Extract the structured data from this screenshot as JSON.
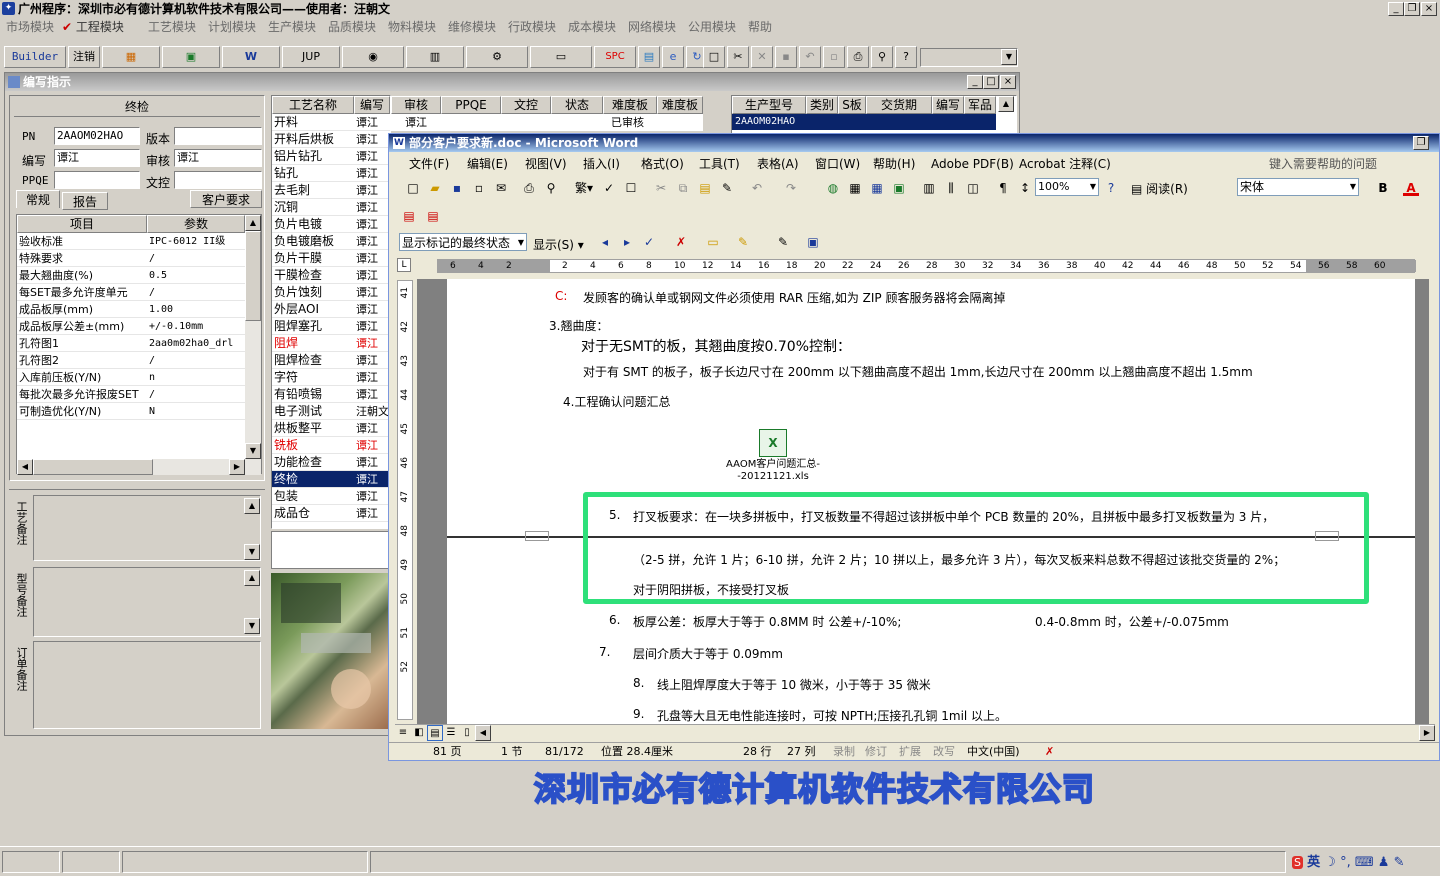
{
  "main_window": {
    "title": "广州程序：深圳市必有德计算机软件技术有限公司——使用者：汪朝文",
    "controls": [
      "_",
      "□",
      "×"
    ]
  },
  "menubar": [
    "市场模块",
    "✔ 工程模块",
    "工艺模块",
    "计划模块",
    "生产模块",
    "品质模块",
    "物料模块",
    "维修模块",
    "行政模块",
    "成本模块",
    "网络模块",
    "公用模块",
    "帮助"
  ],
  "toolbar": {
    "builder": "Builder",
    "logout": "注销",
    "jup": "JUP",
    "spc": "SPC"
  },
  "child_window": {
    "title": "编写指示",
    "panel_title": "终检",
    "fields": {
      "pn_label": "PN",
      "pn_value": "2AAOM02HAO",
      "version_label": "版本",
      "version_value": "",
      "writer_label": "编写",
      "writer_value": "谭江",
      "reviewer_label": "审核",
      "reviewer_value": "谭江",
      "ppqe_label": "PPQE",
      "ppqe_value": "",
      "doc_label": "文控",
      "doc_value": ""
    },
    "tabs": [
      "常规",
      "报告",
      "客户要求"
    ],
    "param_headers": [
      "项目",
      "参数"
    ],
    "params": [
      {
        "item": "验收标准",
        "value": "IPC-6012 II级"
      },
      {
        "item": "特殊要求",
        "value": "/"
      },
      {
        "item": "最大翘曲度(%)",
        "value": "0.5"
      },
      {
        "item": "每SET最多允许度单元",
        "value": "/"
      },
      {
        "item": "成品板厚(mm)",
        "value": "1.00"
      },
      {
        "item": "成品板厚公差±(mm)",
        "value": "+/-0.10mm"
      },
      {
        "item": "孔符图1",
        "value": "2aa0m02ha0_drl"
      },
      {
        "item": "孔符图2",
        "value": "/"
      },
      {
        "item": "入库前压板(Y/N)",
        "value": "n"
      },
      {
        "item": "每批次最多允许报废SET",
        "value": "/"
      },
      {
        "item": "可制造优化(Y/N)",
        "value": "N"
      }
    ],
    "side_labels": [
      "工艺备注",
      "型号备注",
      "订单备注"
    ],
    "process_headers": [
      "工艺名称",
      "编写",
      "审核",
      "PPQE",
      "文控",
      "状态",
      "难度板"
    ],
    "processes": [
      {
        "name": "开料",
        "writer": "谭江",
        "red": false
      },
      {
        "name": "开料后烘板",
        "writer": "谭江",
        "red": false
      },
      {
        "name": "铝片钻孔",
        "writer": "谭江",
        "red": false
      },
      {
        "name": "钻孔",
        "writer": "谭江",
        "red": false
      },
      {
        "name": "去毛刺",
        "writer": "谭江",
        "red": false
      },
      {
        "name": "沉铜",
        "writer": "谭江",
        "red": false
      },
      {
        "name": "负片电镀",
        "writer": "谭江",
        "red": false
      },
      {
        "name": "负电镀磨板",
        "writer": "谭江",
        "red": false
      },
      {
        "name": "负片干膜",
        "writer": "谭江",
        "red": false
      },
      {
        "name": "干膜检查",
        "writer": "谭江",
        "red": false
      },
      {
        "name": "负片蚀刻",
        "writer": "谭江",
        "red": false
      },
      {
        "name": "外层AOI",
        "writer": "谭江",
        "red": false
      },
      {
        "name": "阻焊塞孔",
        "writer": "谭江",
        "red": false
      },
      {
        "name": "阻焊",
        "writer": "谭江",
        "red": true
      },
      {
        "name": "阻焊检查",
        "writer": "谭江",
        "red": false
      },
      {
        "name": "字符",
        "writer": "谭江",
        "red": false
      },
      {
        "name": "有铅喷锡",
        "writer": "谭江",
        "red": false
      },
      {
        "name": "电子测试",
        "writer": "汪朝文",
        "red": false
      },
      {
        "name": "烘板整平",
        "writer": "谭江",
        "red": false
      },
      {
        "name": "铣板",
        "writer": "谭江",
        "red": true
      },
      {
        "name": "功能检查",
        "writer": "谭江",
        "red": false
      },
      {
        "name": "终检",
        "writer": "谭江",
        "red": false,
        "selected": true
      },
      {
        "name": "包装",
        "writer": "谭江",
        "red": false
      },
      {
        "name": "成品仓",
        "writer": "谭江",
        "red": false
      }
    ],
    "first_row_review": "谭江",
    "first_row_status": "已审核",
    "prod_headers": [
      "生产型号",
      "类别",
      "S板",
      "交货期",
      "编写",
      "军品"
    ],
    "prod_value": "2AAOM02HAO"
  },
  "word": {
    "title": "部分客户要求新.doc - Microsoft Word",
    "menu": [
      "文件(F)",
      "编辑(E)",
      "视图(V)",
      "插入(I)",
      "格式(O)",
      "工具(T)",
      "表格(A)",
      "窗口(W)",
      "帮助(H)",
      "Adobe PDF(B)",
      "Acrobat 注释(C)"
    ],
    "help_placeholder": "键入需要帮助的问题",
    "zoom": "100%",
    "read_label": "阅读(R)",
    "font": "宋体",
    "show_state": "显示标记的最终状态",
    "show_menu": "显示(S)",
    "ruler": [
      "6",
      "4",
      "2",
      "",
      "2",
      "4",
      "6",
      "8",
      "10",
      "12",
      "14",
      "16",
      "18",
      "20",
      "22",
      "24",
      "26",
      "28",
      "30",
      "32",
      "34",
      "36",
      "38",
      "40",
      "42",
      "44",
      "46",
      "48",
      "50",
      "52",
      "54",
      "56",
      "58",
      "60"
    ],
    "vruler": [
      "41",
      "42",
      "43",
      "44",
      "45",
      "46",
      "47",
      "48",
      "49",
      "50",
      "51",
      "52"
    ],
    "doc_lines": {
      "c_label": "C:",
      "c_text": "发顾客的确认单或钢网文件必须使用 RAR 压缩,如为 ZIP 顾客服务器将会隔离掉",
      "s3": "3.翘曲度：",
      "s3a": "对于无SMT的板，其翘曲度按0.70%控制：",
      "s3b": "对于有 SMT 的板子，板子长边尺寸在 200mm 以下翘曲高度不超出 1mm,长边尺寸在 200mm 以上翘曲高度不超出 1.5mm",
      "s4": "4.工程确认问题汇总",
      "attach": "AAOM客户问题汇总-\n-20121121.xls",
      "i5_num": "5.",
      "i5": "打叉板要求：在一块多拼板中，打叉板数量不得超过该拼板中单个 PCB 数量的 20%，且拼板中最多打叉板数量为 3 片，",
      "i5b": "（2-5 拼，允许 1 片；6-10 拼，允许 2 片；10 拼以上，最多允许 3 片），每次叉板来料总数不得超过该批交货量的 2%；",
      "i5c": "对于阴阳拼板，不接受打叉板",
      "i6_num": "6.",
      "i6": "板厚公差：板厚大于等于 0.8MM 时   公差+/-10%;",
      "i6b": "0.4-0.8mm 时，公差+/-0.075mm",
      "i7_num": "7.",
      "i7": "层间介质大于等于 0.09mm",
      "i8_num": "8.",
      "i8": "线上阻焊厚度大于等于 10 微米，小于等于 35 微米",
      "i9_num": "9.",
      "i9": "孔盘等大且无电性能连接时，可按 NPTH;压接孔孔铜 1mil 以上。"
    },
    "status": {
      "page": "81 页",
      "section": "1 节",
      "pages": "81/172",
      "position": "位置 28.4厘米",
      "line": "28 行",
      "col": "27 列",
      "rec": "录制",
      "trk": "修订",
      "ext": "扩展",
      "ovr": "改写",
      "lang": "中文(中国)"
    }
  },
  "company_banner": "深圳市必有德计算机软件技术有限公司",
  "tray": {
    "ime": "英"
  },
  "colors": {
    "highlight_box": "#2ee07a",
    "word_title": "#0a246a",
    "selection": "#0a246a",
    "red_text": "#e00000",
    "banner": "#2a50c8"
  }
}
